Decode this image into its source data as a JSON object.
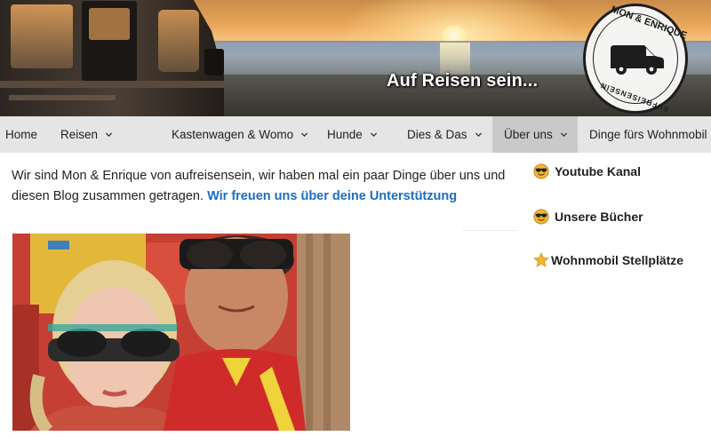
{
  "header": {
    "title": "Auf Reisen sein...",
    "badge_top": "MON & ENRIQUE",
    "badge_bottom": "AUFREISENSEIN"
  },
  "nav": {
    "items": [
      {
        "label": "Home",
        "dropdown": false
      },
      {
        "label": "Reisen",
        "dropdown": true
      },
      {
        "label": "Kastenwagen & Womo",
        "dropdown": true
      },
      {
        "label": "Hunde",
        "dropdown": true
      },
      {
        "label": "Dies & Das",
        "dropdown": true
      },
      {
        "label": "Über uns",
        "dropdown": true,
        "active": true
      },
      {
        "label": "Dinge fürs Wohnmobil",
        "dropdown": false
      }
    ]
  },
  "main": {
    "intro_text": "Wir sind Mon & Enrique von aufreisensein, wir haben mal ein paar Dinge über uns und diesen Blog zusammen getragen. ",
    "support_link": "Wir freuen uns über deine Unterstützung"
  },
  "sidebar": {
    "items": [
      {
        "label": "Youtube Kanal",
        "icon": "sunglasses-smiley-icon"
      },
      {
        "label": "Unsere Bücher",
        "icon": "sunglasses-smiley-icon"
      },
      {
        "label": "Wohnmobil Stellplätze",
        "icon": "star-icon"
      }
    ]
  },
  "colors": {
    "nav_bg": "#e5e5e5",
    "nav_active_bg": "#c9c9c9",
    "link": "#1b6ec2"
  }
}
